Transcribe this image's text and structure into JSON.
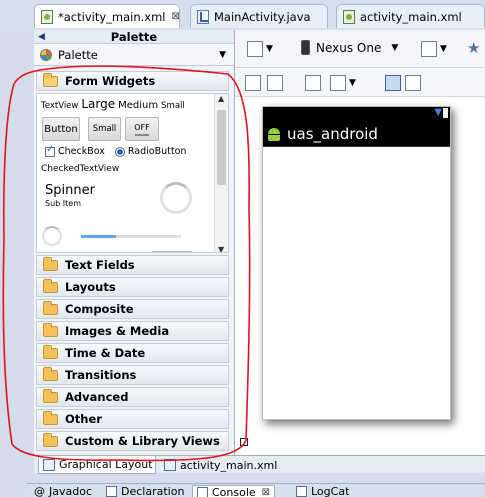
{
  "editor_tabs": [
    {
      "label": "*activity_main.xml",
      "icon": "layout-xml-icon",
      "active": true,
      "closable": true
    },
    {
      "label": "MainActivity.java",
      "icon": "java-file-icon",
      "active": false
    },
    {
      "label": "activity_main.xml",
      "icon": "layout-xml-icon",
      "active": false
    }
  ],
  "palette": {
    "title": "Palette",
    "selector_label": "Palette",
    "categories": [
      {
        "label": "Form Widgets",
        "expanded": true
      },
      {
        "label": "Text Fields"
      },
      {
        "label": "Layouts"
      },
      {
        "label": "Composite"
      },
      {
        "label": "Images & Media"
      },
      {
        "label": "Time & Date"
      },
      {
        "label": "Transitions"
      },
      {
        "label": "Advanced"
      },
      {
        "label": "Other"
      },
      {
        "label": "Custom & Library Views"
      }
    ],
    "form_widgets": {
      "textview": "TextView",
      "large": "Large",
      "medium": "Medium",
      "small": "Small",
      "button": "Button",
      "small_button": "Small",
      "toggle": "OFF",
      "checkbox": "CheckBox",
      "radio": "RadioButton",
      "checked_textview": "CheckedTextView",
      "spinner": "Spinner",
      "spinner_sub": "Sub Item",
      "progress_fraction": 0.35
    }
  },
  "toolbar": {
    "device": "Nexus One"
  },
  "phone": {
    "app_title": "uas_android"
  },
  "bottom_tabs": [
    {
      "label": "Graphical Layout",
      "active": true
    },
    {
      "label": "activity_main.xml",
      "active": false
    }
  ],
  "view_tabs": [
    {
      "label": "Javadoc",
      "prefix": "@"
    },
    {
      "label": "Declaration"
    },
    {
      "label": "Console",
      "active": true
    },
    {
      "label": "LogCat"
    }
  ],
  "colors": {
    "annotation": "#e0141e",
    "accent": "#1c5ec5"
  }
}
